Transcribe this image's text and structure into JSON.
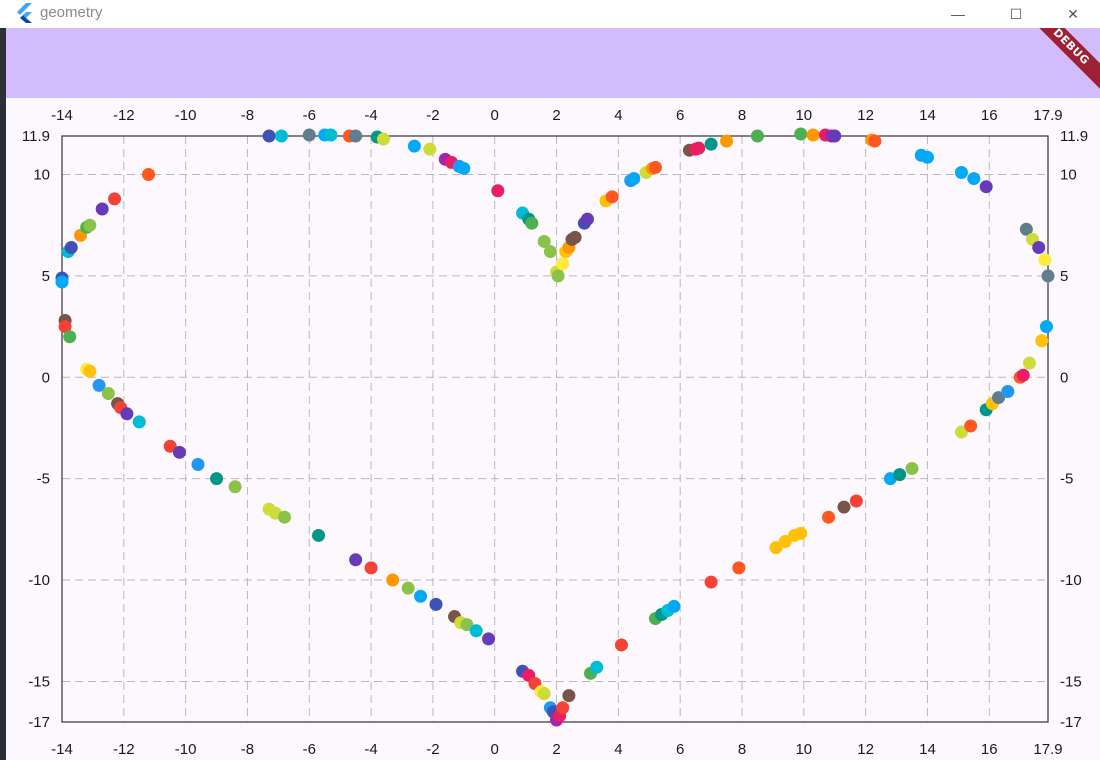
{
  "window": {
    "title": "geometry",
    "minimize_label": "—",
    "maximize_label": "☐",
    "close_label": "✕"
  },
  "appbar": {
    "debug_label": "DEBUG",
    "color": "#d3bcfb"
  },
  "chart_data": {
    "type": "scatter",
    "xlim": [
      -14,
      17.9
    ],
    "ylim": [
      -17,
      11.9
    ],
    "x_ticks": [
      "-14",
      "-12",
      "-10",
      "-8",
      "-6",
      "-4",
      "-2",
      "0",
      "2",
      "4",
      "6",
      "8",
      "10",
      "12",
      "14",
      "16",
      "17.9"
    ],
    "x_tick_values": [
      -14,
      -12,
      -10,
      -8,
      -6,
      -4,
      -2,
      0,
      2,
      4,
      6,
      8,
      10,
      12,
      14,
      16,
      17.9
    ],
    "y_ticks": [
      "11.9",
      "10",
      "5",
      "0",
      "-5",
      "-10",
      "-15",
      "-17"
    ],
    "y_tick_values": [
      11.9,
      10,
      5,
      0,
      -5,
      -10,
      -15,
      -17
    ],
    "grid": true,
    "points": [
      {
        "x": -7.3,
        "y": 11.9,
        "c": "#3f51b5"
      },
      {
        "x": -6.9,
        "y": 11.9,
        "c": "#00bcd4"
      },
      {
        "x": -6.0,
        "y": 11.95,
        "c": "#607d8b"
      },
      {
        "x": -5.5,
        "y": 11.95,
        "c": "#03a9f4"
      },
      {
        "x": -5.3,
        "y": 11.95,
        "c": "#00bcd4"
      },
      {
        "x": -4.7,
        "y": 11.9,
        "c": "#ff5722"
      },
      {
        "x": -4.5,
        "y": 11.9,
        "c": "#607d8b"
      },
      {
        "x": -3.8,
        "y": 11.85,
        "c": "#009688"
      },
      {
        "x": -3.6,
        "y": 11.75,
        "c": "#cddc39"
      },
      {
        "x": -2.6,
        "y": 11.4,
        "c": "#03a9f4"
      },
      {
        "x": -2.1,
        "y": 11.25,
        "c": "#cddc39"
      },
      {
        "x": -1.6,
        "y": 10.75,
        "c": "#9c27b0"
      },
      {
        "x": -1.4,
        "y": 10.6,
        "c": "#e91e63"
      },
      {
        "x": -1.15,
        "y": 10.4,
        "c": "#2196f3"
      },
      {
        "x": -1.0,
        "y": 10.3,
        "c": "#03a9f4"
      },
      {
        "x": 0.1,
        "y": 9.2,
        "c": "#e91e63"
      },
      {
        "x": 0.9,
        "y": 8.1,
        "c": "#00bcd4"
      },
      {
        "x": 1.1,
        "y": 7.8,
        "c": "#009688"
      },
      {
        "x": 1.2,
        "y": 7.6,
        "c": "#4caf50"
      },
      {
        "x": 1.6,
        "y": 6.7,
        "c": "#8bc34a"
      },
      {
        "x": 1.8,
        "y": 6.2,
        "c": "#8bc34a"
      },
      {
        "x": 2.0,
        "y": 5.2,
        "c": "#cddc39"
      },
      {
        "x": 2.05,
        "y": 5.0,
        "c": "#8bc34a"
      },
      {
        "x": 2.2,
        "y": 5.6,
        "c": "#ffeb3b"
      },
      {
        "x": 2.3,
        "y": 6.2,
        "c": "#ffc107"
      },
      {
        "x": 2.4,
        "y": 6.4,
        "c": "#ff9800"
      },
      {
        "x": 2.5,
        "y": 6.8,
        "c": "#795548"
      },
      {
        "x": 2.6,
        "y": 6.9,
        "c": "#795548"
      },
      {
        "x": 2.9,
        "y": 7.6,
        "c": "#3f51b5"
      },
      {
        "x": 3.0,
        "y": 7.8,
        "c": "#673ab7"
      },
      {
        "x": 3.6,
        "y": 8.7,
        "c": "#ffc107"
      },
      {
        "x": 3.8,
        "y": 8.9,
        "c": "#ff5722"
      },
      {
        "x": 4.4,
        "y": 9.7,
        "c": "#2196f3"
      },
      {
        "x": 4.5,
        "y": 9.8,
        "c": "#03a9f4"
      },
      {
        "x": 4.9,
        "y": 10.1,
        "c": "#cddc39"
      },
      {
        "x": 5.1,
        "y": 10.3,
        "c": "#ff9800"
      },
      {
        "x": 5.2,
        "y": 10.35,
        "c": "#ff5722"
      },
      {
        "x": 6.3,
        "y": 11.2,
        "c": "#795548"
      },
      {
        "x": 6.5,
        "y": 11.25,
        "c": "#e91e63"
      },
      {
        "x": 6.6,
        "y": 11.3,
        "c": "#e91e63"
      },
      {
        "x": 7.0,
        "y": 11.5,
        "c": "#009688"
      },
      {
        "x": 7.5,
        "y": 11.65,
        "c": "#ff9800"
      },
      {
        "x": 8.5,
        "y": 11.9,
        "c": "#4caf50"
      },
      {
        "x": 9.9,
        "y": 12.0,
        "c": "#4caf50"
      },
      {
        "x": 10.3,
        "y": 11.95,
        "c": "#ff9800"
      },
      {
        "x": 10.7,
        "y": 11.95,
        "c": "#e91e63"
      },
      {
        "x": 10.9,
        "y": 11.9,
        "c": "#9c27b0"
      },
      {
        "x": 11.0,
        "y": 11.9,
        "c": "#673ab7"
      },
      {
        "x": 12.2,
        "y": 11.7,
        "c": "#ff9800"
      },
      {
        "x": 12.3,
        "y": 11.65,
        "c": "#ff5722"
      },
      {
        "x": 13.8,
        "y": 10.95,
        "c": "#03a9f4"
      },
      {
        "x": 14.0,
        "y": 10.85,
        "c": "#03a9f4"
      },
      {
        "x": 15.1,
        "y": 10.1,
        "c": "#03a9f4"
      },
      {
        "x": 15.5,
        "y": 9.8,
        "c": "#03a9f4"
      },
      {
        "x": 15.9,
        "y": 9.4,
        "c": "#673ab7"
      },
      {
        "x": 17.2,
        "y": 7.3,
        "c": "#607d8b"
      },
      {
        "x": 17.4,
        "y": 6.8,
        "c": "#cddc39"
      },
      {
        "x": 17.6,
        "y": 6.4,
        "c": "#673ab7"
      },
      {
        "x": 17.8,
        "y": 5.8,
        "c": "#ffeb3b"
      },
      {
        "x": 17.9,
        "y": 5.0,
        "c": "#607d8b"
      },
      {
        "x": -14.0,
        "y": 4.9,
        "c": "#3f51b5"
      },
      {
        "x": -14.0,
        "y": 4.7,
        "c": "#03a9f4"
      },
      {
        "x": -13.8,
        "y": 6.2,
        "c": "#00bcd4"
      },
      {
        "x": -13.7,
        "y": 6.4,
        "c": "#3f51b5"
      },
      {
        "x": -13.4,
        "y": 7.0,
        "c": "#ff9800"
      },
      {
        "x": -13.2,
        "y": 7.4,
        "c": "#4caf50"
      },
      {
        "x": -13.1,
        "y": 7.5,
        "c": "#8bc34a"
      },
      {
        "x": -12.7,
        "y": 8.3,
        "c": "#673ab7"
      },
      {
        "x": -12.3,
        "y": 8.8,
        "c": "#f44336"
      },
      {
        "x": -11.2,
        "y": 10.0,
        "c": "#ff5722"
      },
      {
        "x": -13.9,
        "y": 2.8,
        "c": "#795548"
      },
      {
        "x": -13.9,
        "y": 2.5,
        "c": "#f44336"
      },
      {
        "x": -13.75,
        "y": 2.0,
        "c": "#4caf50"
      },
      {
        "x": -13.2,
        "y": 0.4,
        "c": "#ffeb3b"
      },
      {
        "x": -13.1,
        "y": 0.3,
        "c": "#ffc107"
      },
      {
        "x": -12.8,
        "y": -0.4,
        "c": "#2196f3"
      },
      {
        "x": -12.5,
        "y": -0.8,
        "c": "#8bc34a"
      },
      {
        "x": -12.2,
        "y": -1.3,
        "c": "#795548"
      },
      {
        "x": -12.1,
        "y": -1.5,
        "c": "#f44336"
      },
      {
        "x": -11.9,
        "y": -1.8,
        "c": "#673ab7"
      },
      {
        "x": -11.5,
        "y": -2.2,
        "c": "#00bcd4"
      },
      {
        "x": -10.5,
        "y": -3.4,
        "c": "#f44336"
      },
      {
        "x": -10.2,
        "y": -3.7,
        "c": "#673ab7"
      },
      {
        "x": -9.6,
        "y": -4.3,
        "c": "#2196f3"
      },
      {
        "x": -9.0,
        "y": -5.0,
        "c": "#009688"
      },
      {
        "x": -8.4,
        "y": -5.4,
        "c": "#8bc34a"
      },
      {
        "x": -7.3,
        "y": -6.5,
        "c": "#cddc39"
      },
      {
        "x": -7.1,
        "y": -6.7,
        "c": "#cddc39"
      },
      {
        "x": -6.8,
        "y": -6.9,
        "c": "#8bc34a"
      },
      {
        "x": -5.7,
        "y": -7.8,
        "c": "#009688"
      },
      {
        "x": -4.5,
        "y": -9.0,
        "c": "#673ab7"
      },
      {
        "x": -4.0,
        "y": -9.4,
        "c": "#f44336"
      },
      {
        "x": -3.3,
        "y": -10.0,
        "c": "#ff9800"
      },
      {
        "x": -2.8,
        "y": -10.4,
        "c": "#8bc34a"
      },
      {
        "x": -2.4,
        "y": -10.8,
        "c": "#03a9f4"
      },
      {
        "x": -1.9,
        "y": -11.2,
        "c": "#3f51b5"
      },
      {
        "x": -1.3,
        "y": -11.8,
        "c": "#795548"
      },
      {
        "x": -1.1,
        "y": -12.1,
        "c": "#cddc39"
      },
      {
        "x": -0.9,
        "y": -12.2,
        "c": "#8bc34a"
      },
      {
        "x": -0.6,
        "y": -12.5,
        "c": "#00bcd4"
      },
      {
        "x": -0.2,
        "y": -12.9,
        "c": "#673ab7"
      },
      {
        "x": 0.9,
        "y": -14.5,
        "c": "#3f51b5"
      },
      {
        "x": 1.1,
        "y": -14.7,
        "c": "#e91e63"
      },
      {
        "x": 1.3,
        "y": -15.1,
        "c": "#f44336"
      },
      {
        "x": 1.5,
        "y": -15.5,
        "c": "#ffeb3b"
      },
      {
        "x": 1.6,
        "y": -15.6,
        "c": "#cddc39"
      },
      {
        "x": 1.8,
        "y": -16.3,
        "c": "#2196f3"
      },
      {
        "x": 1.9,
        "y": -16.5,
        "c": "#3f51b5"
      },
      {
        "x": 2.0,
        "y": -16.9,
        "c": "#9c27b0"
      },
      {
        "x": 2.1,
        "y": -16.7,
        "c": "#e91e63"
      },
      {
        "x": 2.2,
        "y": -16.3,
        "c": "#f44336"
      },
      {
        "x": 2.4,
        "y": -15.7,
        "c": "#795548"
      },
      {
        "x": 3.1,
        "y": -14.6,
        "c": "#4caf50"
      },
      {
        "x": 3.3,
        "y": -14.3,
        "c": "#00bcd4"
      },
      {
        "x": 4.1,
        "y": -13.2,
        "c": "#f44336"
      },
      {
        "x": 5.2,
        "y": -11.9,
        "c": "#4caf50"
      },
      {
        "x": 5.4,
        "y": -11.7,
        "c": "#009688"
      },
      {
        "x": 5.6,
        "y": -11.5,
        "c": "#00bcd4"
      },
      {
        "x": 5.8,
        "y": -11.3,
        "c": "#03a9f4"
      },
      {
        "x": 7.0,
        "y": -10.1,
        "c": "#f44336"
      },
      {
        "x": 7.9,
        "y": -9.4,
        "c": "#ff5722"
      },
      {
        "x": 9.1,
        "y": -8.4,
        "c": "#ffc107"
      },
      {
        "x": 9.4,
        "y": -8.1,
        "c": "#ffc107"
      },
      {
        "x": 9.7,
        "y": -7.8,
        "c": "#ffc107"
      },
      {
        "x": 9.9,
        "y": -7.7,
        "c": "#ffc107"
      },
      {
        "x": 10.8,
        "y": -6.9,
        "c": "#ff5722"
      },
      {
        "x": 11.3,
        "y": -6.4,
        "c": "#795548"
      },
      {
        "x": 11.7,
        "y": -6.1,
        "c": "#f44336"
      },
      {
        "x": 12.8,
        "y": -5.0,
        "c": "#03a9f4"
      },
      {
        "x": 13.1,
        "y": -4.8,
        "c": "#009688"
      },
      {
        "x": 13.5,
        "y": -4.5,
        "c": "#8bc34a"
      },
      {
        "x": 15.1,
        "y": -2.7,
        "c": "#cddc39"
      },
      {
        "x": 15.4,
        "y": -2.4,
        "c": "#ff5722"
      },
      {
        "x": 15.9,
        "y": -1.6,
        "c": "#009688"
      },
      {
        "x": 16.1,
        "y": -1.3,
        "c": "#ffc107"
      },
      {
        "x": 16.3,
        "y": -1.0,
        "c": "#607d8b"
      },
      {
        "x": 16.6,
        "y": -0.7,
        "c": "#2196f3"
      },
      {
        "x": 17.0,
        "y": 0.0,
        "c": "#ff5722"
      },
      {
        "x": 17.1,
        "y": 0.1,
        "c": "#e91e63"
      },
      {
        "x": 17.3,
        "y": 0.7,
        "c": "#cddc39"
      },
      {
        "x": 17.7,
        "y": 1.8,
        "c": "#ffc107"
      },
      {
        "x": 17.85,
        "y": 2.5,
        "c": "#03a9f4"
      }
    ]
  }
}
